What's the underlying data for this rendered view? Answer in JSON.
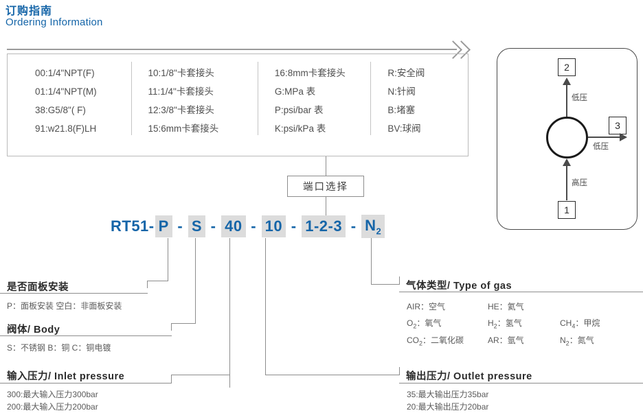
{
  "heading": {
    "title_cn": "订购指南",
    "title_en": "Ordering Information"
  },
  "colors": {
    "accent_blue": "#1565a8",
    "highlight_gray": "#dcdcdc",
    "line_gray": "#8d8d8d",
    "border_gray": "#b9b9b9",
    "text_gray": "#4a4a4a"
  },
  "options_table": {
    "columns": [
      {
        "items": [
          "00:1/4\"NPT(F)",
          "01:1/4\"NPT(M)",
          "38:G5/8\"( F)",
          "91:w21.8(F)LH"
        ]
      },
      {
        "items": [
          "10:1/8\"卡套接头",
          "11:1/4\"卡套接头",
          "12:3/8\"卡套接头",
          "15:6mm卡套接头"
        ]
      },
      {
        "items": [
          "16:8mm卡套接头",
          "G:MPa 表",
          "P:psi/bar 表",
          "K:psi/kPa 表"
        ]
      },
      {
        "items": [
          "R:安全阀",
          "N:针阀",
          "B:堵塞",
          "BV:球阀"
        ]
      }
    ]
  },
  "port_selection": {
    "box_label": "端口选择"
  },
  "model_code": {
    "segments": [
      {
        "text": "RT51-",
        "highlight": false
      },
      {
        "text": "P",
        "highlight": true
      },
      {
        "text": " - ",
        "highlight": false
      },
      {
        "text": "S",
        "highlight": true
      },
      {
        "text": " - ",
        "highlight": false
      },
      {
        "text": "40",
        "highlight": true
      },
      {
        "text": " - ",
        "highlight": false
      },
      {
        "text": "10",
        "highlight": true
      },
      {
        "text": " - ",
        "highlight": false
      },
      {
        "text": "1-2-3",
        "highlight": true
      },
      {
        "text": " - ",
        "highlight": false
      },
      {
        "text": "N",
        "highlight": true,
        "sub": "2"
      }
    ],
    "full_string": "RT51-P-S-40-10-1-2-3-N2"
  },
  "legend": {
    "panel_mount": {
      "title": "是否面板安装",
      "body": "P：面板安装  空白：非面板安装"
    },
    "body_material": {
      "title": "阀体/ Body",
      "body": "S：不锈钢   B：铜   C：铜电镀"
    },
    "inlet_pressure": {
      "title": "输入压力/ Inlet pressure",
      "lines": [
        "300:最大输入压力300bar",
        "200:最大输入压力200bar"
      ]
    },
    "gas_type": {
      "title": "气体类型/ Type of gas",
      "rows": [
        [
          {
            "sym": "AIR",
            "sub": "",
            "name": "：空气"
          },
          {
            "sym": "HE",
            "sub": "",
            "name": "：氦气"
          },
          {
            "sym": "",
            "sub": "",
            "name": ""
          }
        ],
        [
          {
            "sym": "O",
            "sub": "2",
            "name": "：氧气"
          },
          {
            "sym": "H",
            "sub": "2",
            "name": "：氢气"
          },
          {
            "sym": "CH",
            "sub": "4",
            "name": "：甲烷"
          }
        ],
        [
          {
            "sym": "CO",
            "sub": "2",
            "name": "：二氧化碳"
          },
          {
            "sym": "AR",
            "sub": "",
            "name": "：氩气"
          },
          {
            "sym": "N",
            "sub": "2",
            "name": "：氮气"
          }
        ]
      ]
    },
    "outlet_pressure": {
      "title": "输出压力/ Outlet pressure",
      "lines": [
        "35:最大输出压力35bar",
        "20:最大输出压力20bar"
      ]
    }
  },
  "schematic": {
    "port_top": "2",
    "port_right": "3",
    "port_bottom": "1",
    "label_top": "低压",
    "label_right": "低压",
    "label_bottom": "高压"
  }
}
